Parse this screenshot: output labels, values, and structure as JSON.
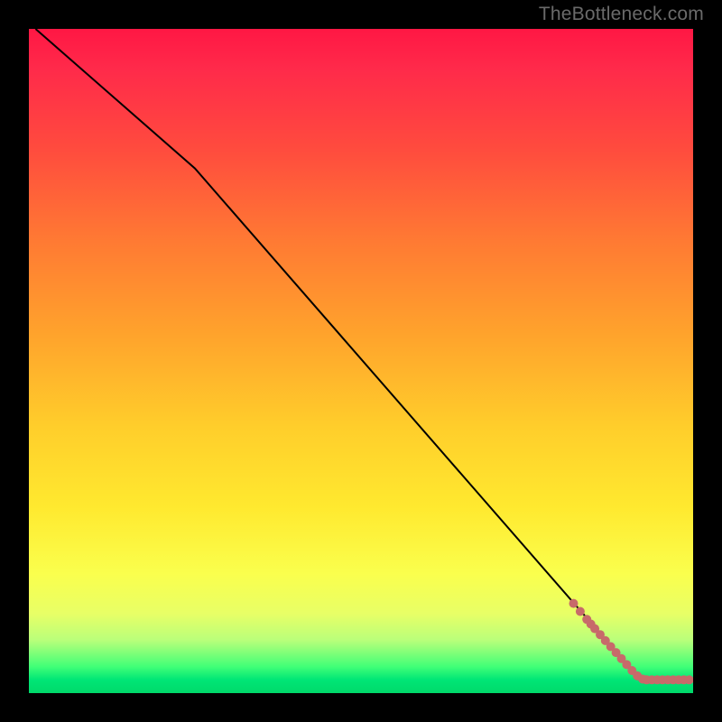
{
  "watermark": "TheBottleneck.com",
  "chart_data": {
    "type": "line",
    "title": "",
    "xlabel": "",
    "ylabel": "",
    "xlim": [
      0,
      100
    ],
    "ylim": [
      0,
      100
    ],
    "curve": {
      "name": "bottleneck-curve",
      "points": [
        {
          "x": 1.0,
          "y": 100.0
        },
        {
          "x": 25.0,
          "y": 79.0
        },
        {
          "x": 86.0,
          "y": 9.0
        },
        {
          "x": 92.0,
          "y": 2.0
        },
        {
          "x": 100.0,
          "y": 2.0
        }
      ]
    },
    "markers": {
      "name": "highlight-region",
      "color": "#c76a6a",
      "points": [
        {
          "x": 82.0,
          "y": 13.5
        },
        {
          "x": 83.0,
          "y": 12.3
        },
        {
          "x": 84.0,
          "y": 11.1
        },
        {
          "x": 84.6,
          "y": 10.4
        },
        {
          "x": 85.2,
          "y": 9.7
        },
        {
          "x": 86.0,
          "y": 8.8
        },
        {
          "x": 86.8,
          "y": 7.9
        },
        {
          "x": 87.6,
          "y": 7.0
        },
        {
          "x": 88.4,
          "y": 6.1
        },
        {
          "x": 89.2,
          "y": 5.2
        },
        {
          "x": 90.0,
          "y": 4.3
        },
        {
          "x": 90.8,
          "y": 3.4
        },
        {
          "x": 91.6,
          "y": 2.6
        },
        {
          "x": 92.4,
          "y": 2.1
        },
        {
          "x": 93.0,
          "y": 2.0
        },
        {
          "x": 93.8,
          "y": 2.0
        },
        {
          "x": 94.6,
          "y": 2.0
        },
        {
          "x": 95.4,
          "y": 2.0
        },
        {
          "x": 96.2,
          "y": 2.0
        },
        {
          "x": 97.0,
          "y": 2.0
        },
        {
          "x": 97.8,
          "y": 2.0
        },
        {
          "x": 98.6,
          "y": 2.0
        },
        {
          "x": 99.4,
          "y": 2.0
        }
      ]
    },
    "gradient_stops": [
      {
        "pos": 0,
        "color": "#ff1744"
      },
      {
        "pos": 50,
        "color": "#ffce2b"
      },
      {
        "pos": 85,
        "color": "#faff4d"
      },
      {
        "pos": 100,
        "color": "#00d96a"
      }
    ]
  }
}
